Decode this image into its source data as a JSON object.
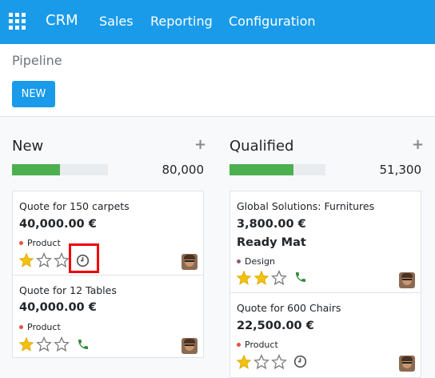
{
  "nav": {
    "brand": "CRM",
    "menu": [
      "Sales",
      "Reporting",
      "Configuration"
    ]
  },
  "control_panel": {
    "breadcrumb": "Pipeline",
    "new_button": "NEW"
  },
  "columns": [
    {
      "title": "New",
      "total": "80,000",
      "progress": 0.5,
      "cards": [
        {
          "title": "Quote for 150 carpets",
          "amount": "40,000.00 €",
          "tag": "Product",
          "tag_color": "#e8523f",
          "stars": 1,
          "activity": "clock"
        },
        {
          "title": "Quote for 12 Tables",
          "amount": "40,000.00 €",
          "tag": "Product",
          "tag_color": "#e8523f",
          "stars": 1,
          "activity": "phone"
        }
      ]
    },
    {
      "title": "Qualified",
      "total": "51,300",
      "progress": 0.67,
      "cards": [
        {
          "title": "Global Solutions: Furnitures",
          "amount": "3,800.00 €",
          "company": "Ready Mat",
          "tag": "Design",
          "tag_color": "#8a5a7d",
          "stars": 2,
          "activity": "phone"
        },
        {
          "title": "Quote for 600 Chairs",
          "amount": "22,500.00 €",
          "tag": "Product",
          "tag_color": "#e8523f",
          "stars": 1,
          "activity": "clock"
        }
      ]
    }
  ],
  "colors": {
    "brand": "#1a9bea",
    "progress": "#4caf50",
    "star": "#f3c10e",
    "phone": "#2e8b3a"
  }
}
